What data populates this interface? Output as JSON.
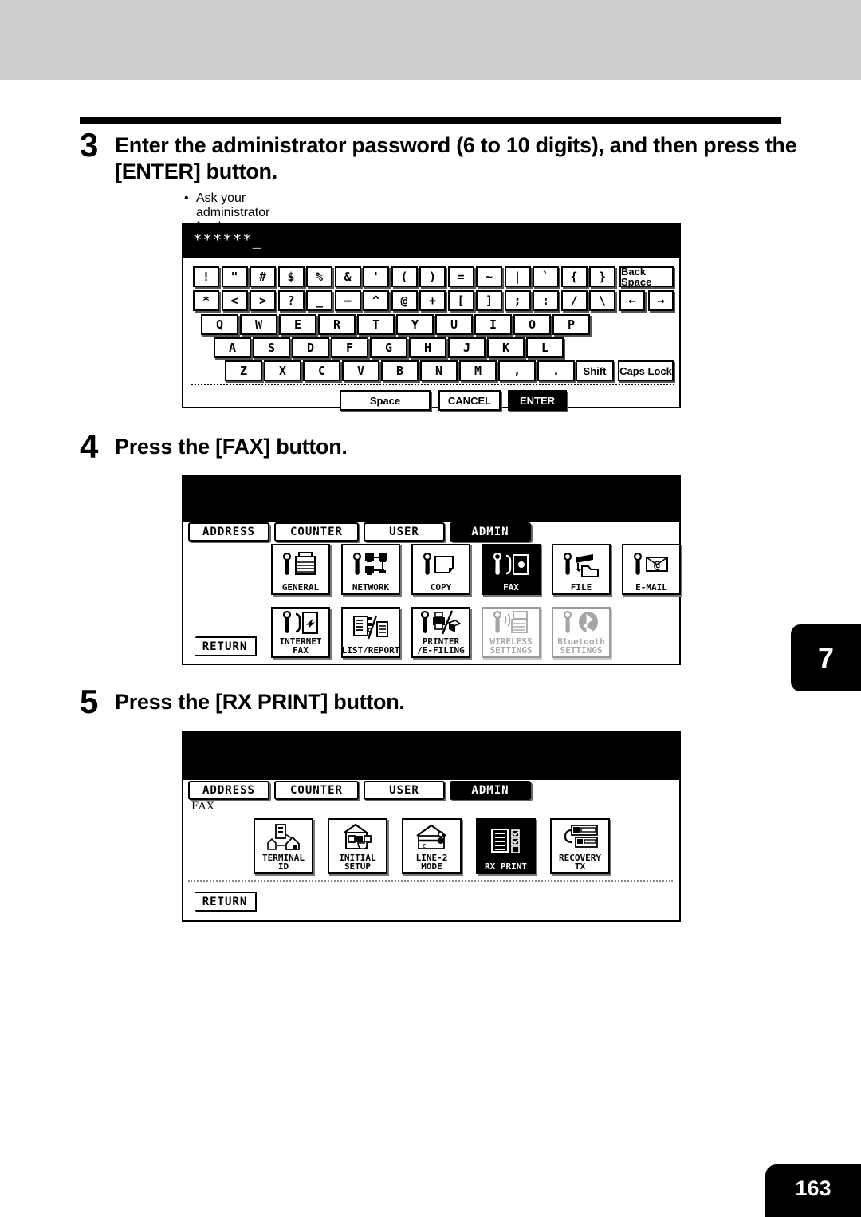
{
  "page": {
    "chapter_tab": "7",
    "page_number": "163"
  },
  "steps": [
    {
      "number": "3",
      "title": "Enter the administrator password (6 to 10 digits), and then press the [ENTER] button.",
      "bullet": "Ask your administrator for the administrator password."
    },
    {
      "number": "4",
      "title": "Press the [FAX] button."
    },
    {
      "number": "5",
      "title": "Press the [RX PRINT] button."
    }
  ],
  "keyboard_screen": {
    "password_value": "******_",
    "rows": [
      [
        "!",
        "\"",
        "#",
        "$",
        "%",
        "&",
        "'",
        "(",
        ")",
        "=",
        "~",
        "|",
        "`",
        "{",
        "}"
      ],
      [
        "*",
        "<",
        ">",
        "?",
        "_",
        "—",
        "^",
        "@",
        "+",
        "[",
        "]",
        ";",
        ":",
        "/",
        "\\"
      ],
      [
        "Q",
        "W",
        "E",
        "R",
        "T",
        "Y",
        "U",
        "I",
        "O",
        "P"
      ],
      [
        "A",
        "S",
        "D",
        "F",
        "G",
        "H",
        "J",
        "K",
        "L"
      ],
      [
        "Z",
        "X",
        "C",
        "V",
        "B",
        "N",
        "M",
        ",",
        "."
      ]
    ],
    "back_space": "Back Space",
    "arrow_left": "←",
    "arrow_right": "→",
    "shift": "Shift",
    "caps_lock": "Caps Lock",
    "space": "Space",
    "cancel": "CANCEL",
    "enter": "ENTER"
  },
  "admin_screen": {
    "tabs": [
      {
        "label": "ADDRESS",
        "selected": false
      },
      {
        "label": "COUNTER",
        "selected": false
      },
      {
        "label": "USER",
        "selected": false
      },
      {
        "label": "ADMIN",
        "selected": true
      }
    ],
    "tiles_row1": [
      {
        "label": "GENERAL",
        "icon": "wrench-copier-icon",
        "state": "normal"
      },
      {
        "label": "NETWORK",
        "icon": "wrench-network-icon",
        "state": "normal"
      },
      {
        "label": "COPY",
        "icon": "wrench-page-icon",
        "state": "normal"
      },
      {
        "label": "FAX",
        "icon": "wrench-fax-icon",
        "state": "selected"
      },
      {
        "label": "FILE",
        "icon": "wrench-file-icon",
        "state": "normal"
      },
      {
        "label": "E-MAIL",
        "icon": "wrench-email-icon",
        "state": "normal"
      }
    ],
    "tiles_row2": [
      {
        "label": "INTERNET FAX",
        "icon": "wrench-internetfax-icon",
        "state": "normal"
      },
      {
        "label": "LIST/REPORT",
        "icon": "list-report-icon",
        "state": "normal"
      },
      {
        "label": "PRINTER\n/E-FILING",
        "icon": "wrench-printer-efiling-icon",
        "state": "normal"
      },
      {
        "label": "WIRELESS\nSETTINGS",
        "icon": "wrench-wireless-icon",
        "state": "disabled"
      },
      {
        "label": "Bluetooth\nSETTINGS",
        "icon": "wrench-bluetooth-icon",
        "state": "disabled"
      }
    ],
    "return_label": "RETURN"
  },
  "fax_screen": {
    "tabs": [
      {
        "label": "ADDRESS",
        "selected": false
      },
      {
        "label": "COUNTER",
        "selected": false
      },
      {
        "label": "USER",
        "selected": false
      },
      {
        "label": "ADMIN",
        "selected": true
      }
    ],
    "section_label": "FAX",
    "tiles": [
      {
        "label": "TERMINAL ID",
        "icon": "terminal-id-icon",
        "state": "normal"
      },
      {
        "label": "INITIAL SETUP",
        "icon": "initial-setup-icon",
        "state": "normal"
      },
      {
        "label": "LINE-2 MODE",
        "icon": "line2-mode-icon",
        "state": "normal"
      },
      {
        "label": "RX PRINT",
        "icon": "rx-print-icon",
        "state": "selected"
      },
      {
        "label": "RECOVERY TX",
        "icon": "recovery-tx-icon",
        "state": "normal"
      }
    ],
    "return_label": "RETURN"
  },
  "colors": {
    "banner": "#cccccc",
    "ink": "#000000",
    "paper": "#ffffff",
    "disabled": "#a8a8a8"
  }
}
